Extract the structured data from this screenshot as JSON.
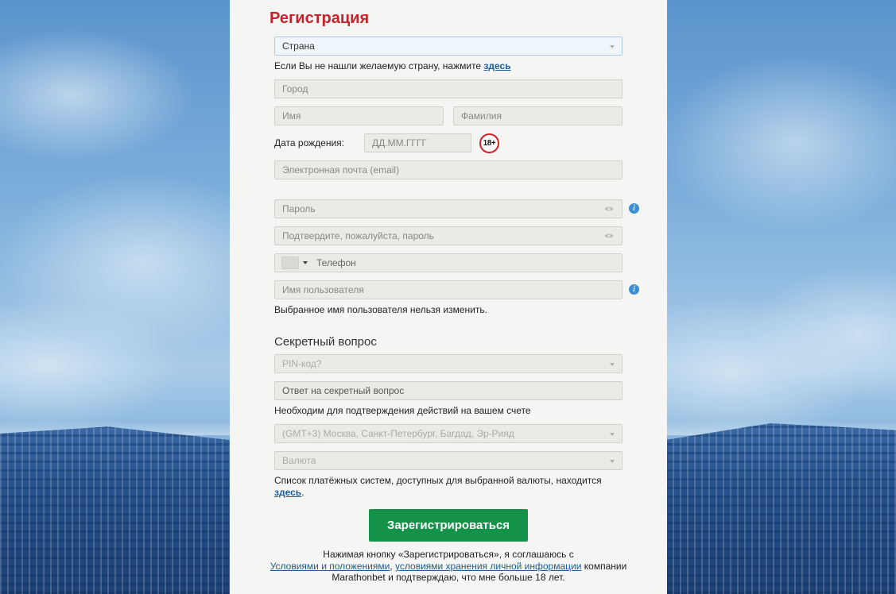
{
  "form": {
    "title": "Регистрация",
    "country": {
      "placeholder": "Страна"
    },
    "country_hint": {
      "text": "Если Вы не нашли желаемую страну, нажмите ",
      "link": "здесь"
    },
    "city": {
      "placeholder": "Город"
    },
    "first_name": {
      "placeholder": "Имя"
    },
    "last_name": {
      "placeholder": "Фамилия"
    },
    "birth_date": {
      "label": "Дата рождения:",
      "placeholder": "ДД.ММ.ГГГГ",
      "age_badge": "18+"
    },
    "email": {
      "placeholder": "Электронная почта (email)"
    },
    "password": {
      "placeholder": "Пароль"
    },
    "password_confirm": {
      "placeholder": "Подтвердите, пожалуйста, пароль"
    },
    "phone": {
      "placeholder": "Телефон"
    },
    "username": {
      "placeholder": "Имя пользователя",
      "note": "Выбранное имя пользователя нельзя изменить."
    },
    "secret_section_title": "Секретный вопрос",
    "secret_question": {
      "value": "PIN-код?"
    },
    "secret_answer": {
      "placeholder": "Ответ на секретный вопрос"
    },
    "secret_note": "Необходим для подтверждения действий на вашем счете",
    "timezone": {
      "value": "(GMT+3) Москва, Санкт-Петербург, Багдад, Эр-Рияд"
    },
    "currency": {
      "value": "Валюта"
    },
    "currency_note": {
      "text": "Список платёжных систем, доступных для выбранной валюты, находится",
      "link": "здесь",
      "tail": "."
    },
    "submit_label": "Зарегистрироваться",
    "footer": {
      "line1": "Нажимая кнопку «Зарегистрироваться», я соглашаюсь с",
      "terms_link": "Условиями и положениями",
      "comma": ",",
      "privacy_link": "условиями хранения личной информации",
      "line2_tail": "компании",
      "line3": "Marathonbet и подтверждаю, что мне больше 18 лет."
    }
  },
  "icons": {
    "info": "info-icon",
    "eye": "eye-icon",
    "caret": "chevron-down-icon"
  },
  "colors": {
    "title": "#c8232c",
    "submit": "#14924a",
    "link": "#1b5ea0",
    "info": "#3c8ed6",
    "age_badge_ring": "#d32229"
  }
}
